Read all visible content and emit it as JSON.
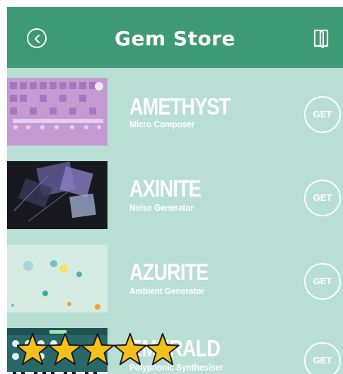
{
  "header": {
    "title": "Gem Store",
    "back_icon": "back-circle-icon",
    "book_icon": "book-icon"
  },
  "colors": {
    "header_bg": "#3e9a76",
    "list_bg": "#b9dfd4",
    "star": "#f4c01e"
  },
  "items": [
    {
      "name": "AMETHYST",
      "subtitle": "Micro Composer",
      "button": "GET"
    },
    {
      "name": "AXINITE",
      "subtitle": "Noise Generator",
      "button": "GET"
    },
    {
      "name": "AZURITE",
      "subtitle": "Ambient Generator",
      "button": "GET"
    },
    {
      "name": "EMERALD",
      "subtitle": "Polyphonic Synthesiser",
      "button": "GET"
    }
  ],
  "rating": {
    "stars": 5,
    "max": 5
  }
}
